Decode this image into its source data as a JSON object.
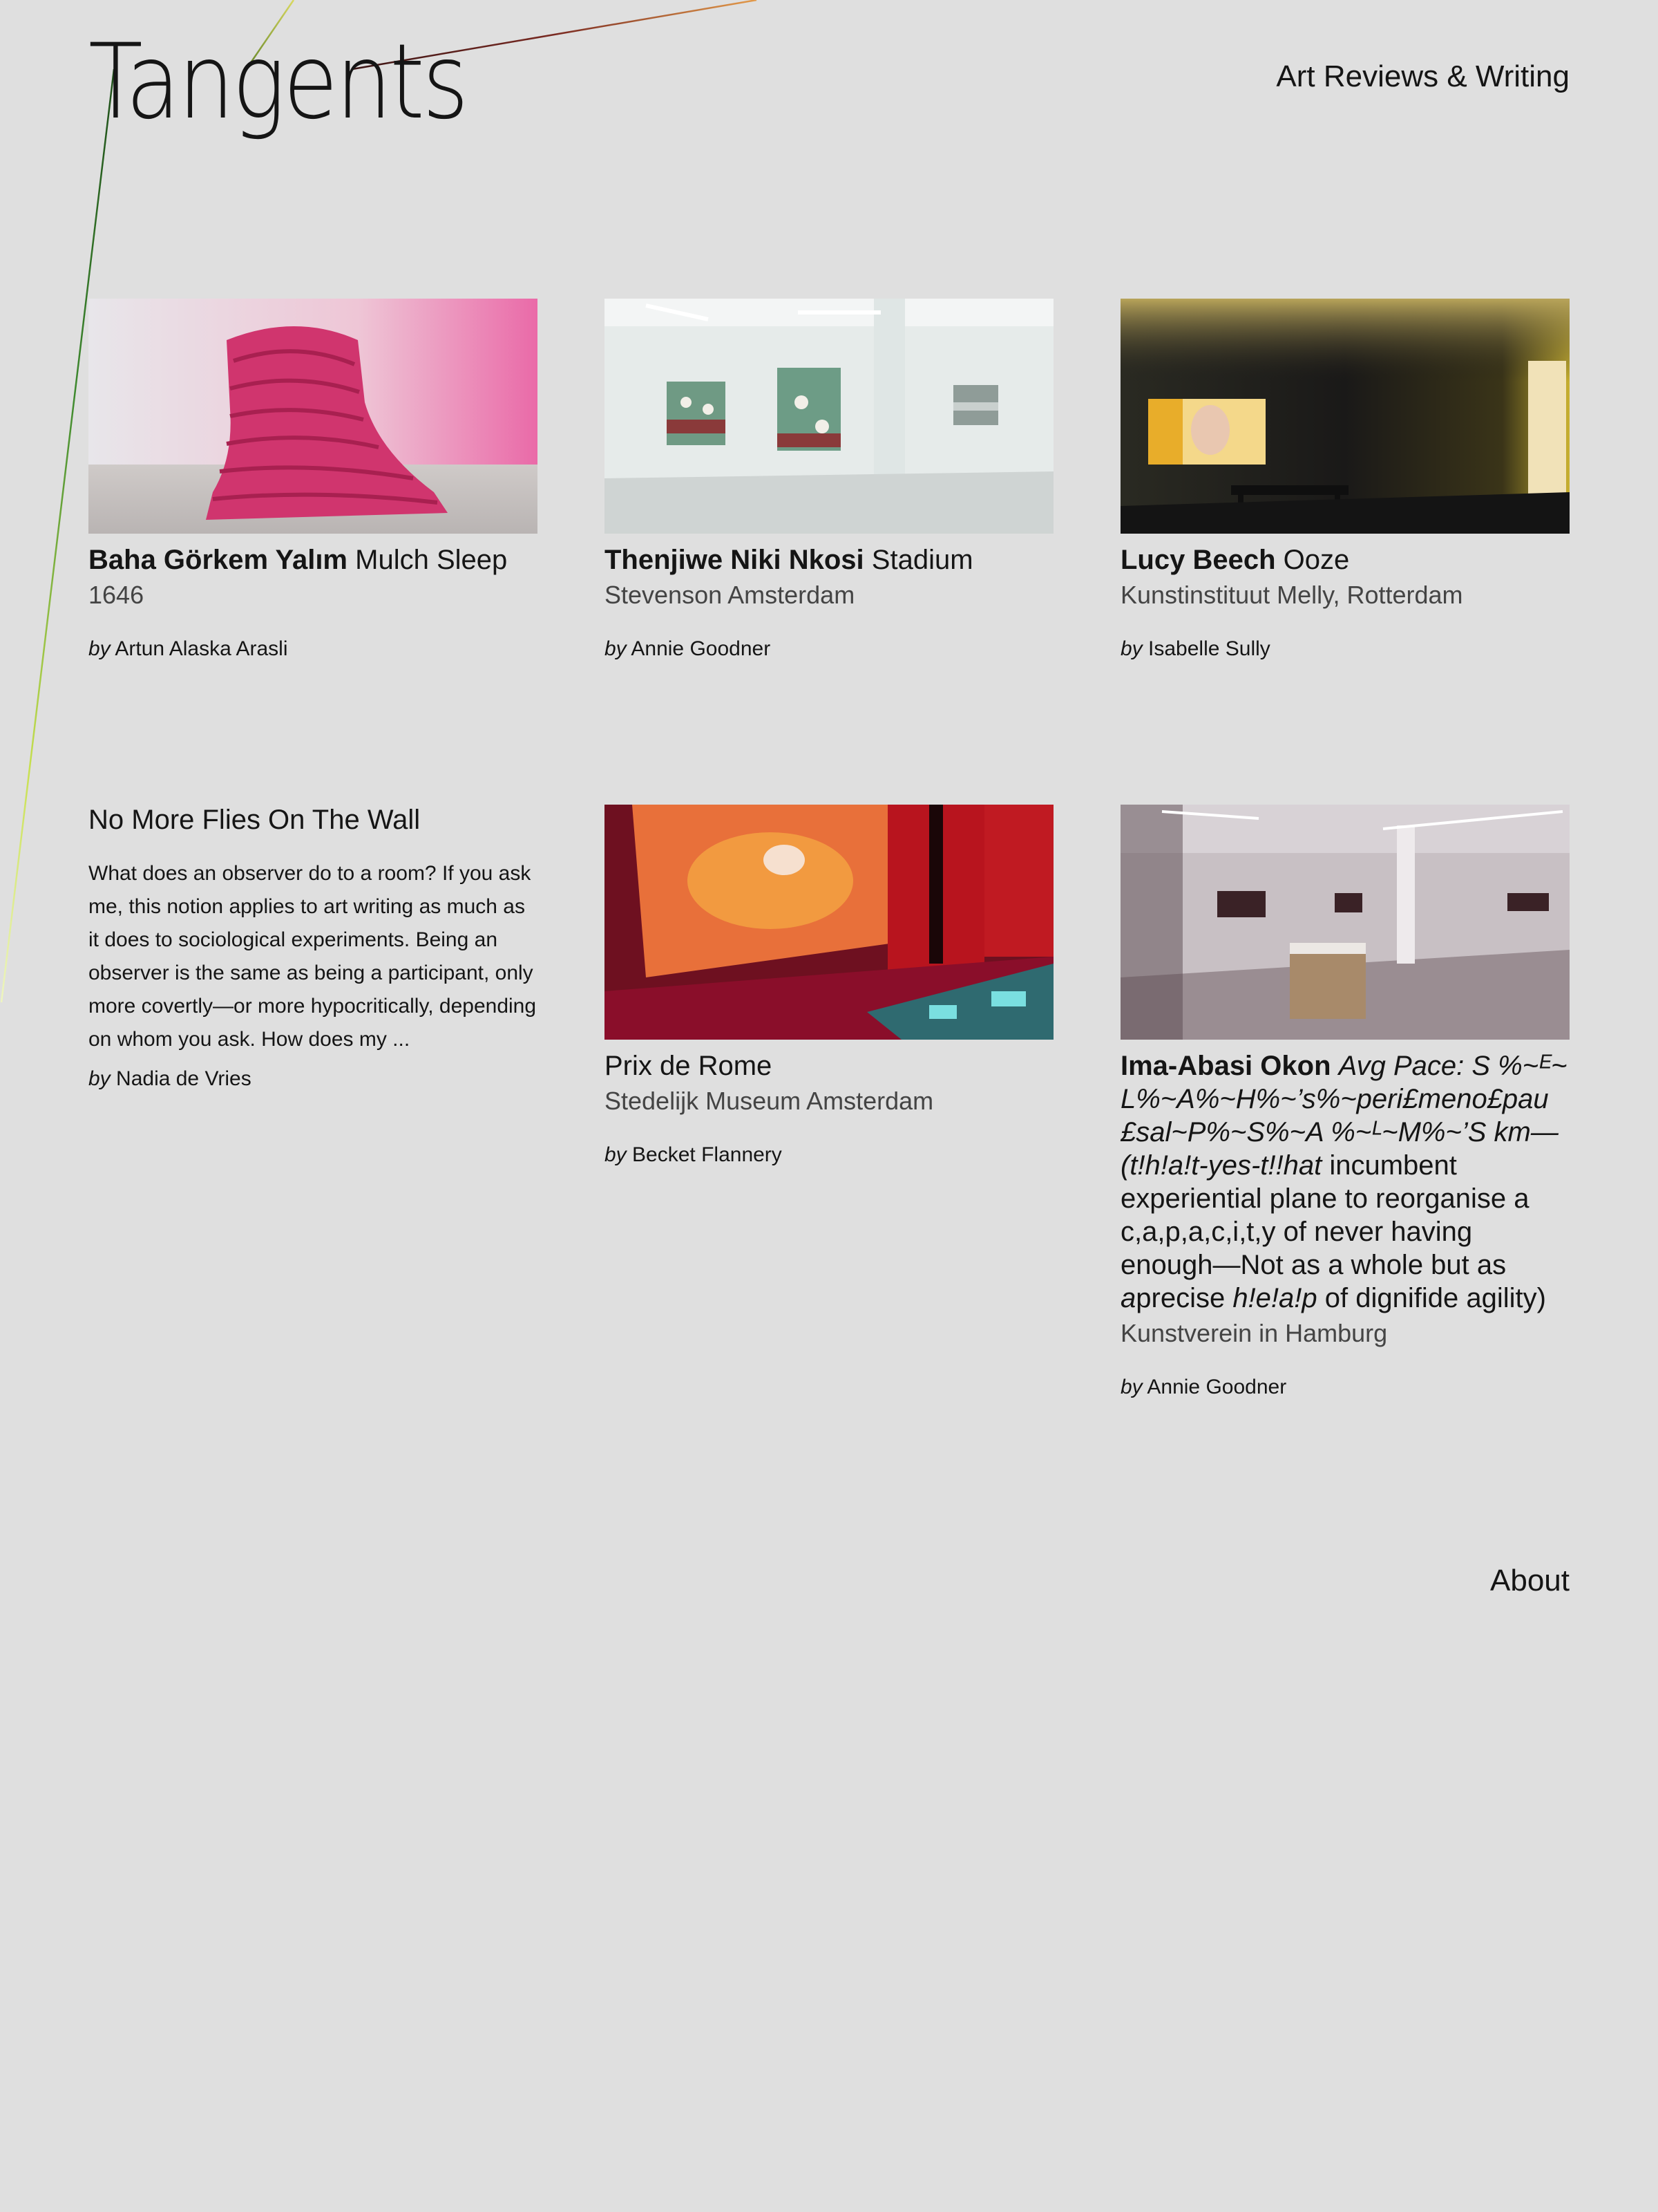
{
  "header": {
    "logo": "Tangents",
    "nav_label": "Art Reviews & Writing"
  },
  "cards": [
    {
      "artist": "Baha Görkem Yalım",
      "work": "Mulch Sleep",
      "venue": "1646",
      "by_prefix": "by",
      "author": "Artun Alaska Arasli"
    },
    {
      "artist": "Thenjiwe Niki Nkosi",
      "work": "Stadium",
      "venue": "Stevenson Amsterdam",
      "by_prefix": "by",
      "author": "Annie Goodner"
    },
    {
      "artist": "Lucy Beech",
      "work": "Ooze",
      "venue": "Kunstinstituut Melly, Rotterdam",
      "by_prefix": "by",
      "author": "Isabelle Sully"
    },
    {
      "artist": "",
      "work": "Prix de Rome",
      "venue": "Stedelijk Museum Amsterdam",
      "by_prefix": "by",
      "author": "Becket Flannery"
    },
    {
      "artist": "Ima-Abasi Okon",
      "work_italic_1": "Avg Pace: S %~ᴱ~ L%~A%~H%~’s%~peri£meno£pau £sal~P%~S%~A %~ᴸ~M%~’S km—(t!h!a!t-yes-t!!hat",
      "work_roman_1": " incumbent experiential plane to reorganise a c,a,p,a,c,i,t,y of never having enough—Not as a whole but as ",
      "work_italic_2": "a",
      "work_roman_2": "precise ",
      "work_italic_3": "h!e!a!p",
      "work_roman_3": " of dignifide agility)",
      "venue": "Kunstverein in Hamburg",
      "by_prefix": "by",
      "author": "Annie Goodner"
    }
  ],
  "essay": {
    "title": "No More Flies On The Wall",
    "excerpt": "What does an observer do to a room? If you ask me, this notion applies to art writing as much as it does to sociological experiments. Being an observer is the same as being a participant, only more covertly—or more hypocritically, depending on whom you ask. How does my ...",
    "by_prefix": "by",
    "author": "Nadia de Vries"
  },
  "footer": {
    "about_label": "About"
  },
  "colors": {
    "background": "#dfdfdf",
    "text": "#151515",
    "secondary_text": "#444444",
    "line_green": "#2f6b2a",
    "line_lime": "#c8e050",
    "line_orange": "#d98a3a",
    "line_maroon": "#6b2222"
  }
}
